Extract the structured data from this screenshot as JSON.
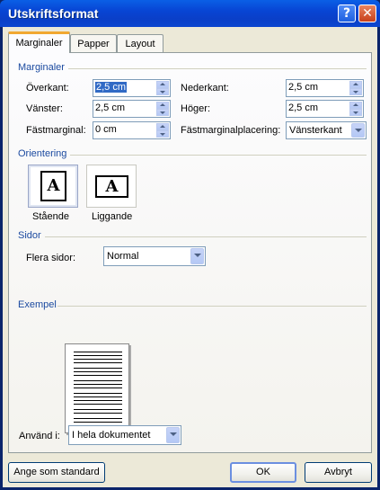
{
  "window": {
    "title": "Utskriftsformat",
    "help_glyph": "?",
    "close_glyph": "✕"
  },
  "tabs": [
    {
      "label": "Marginaler",
      "active": true
    },
    {
      "label": "Papper",
      "active": false
    },
    {
      "label": "Layout",
      "active": false
    }
  ],
  "margins": {
    "section_label": "Marginaler",
    "top": {
      "label": "Överkant:",
      "value": "2,5 cm"
    },
    "bottom": {
      "label": "Nederkant:",
      "value": "2,5 cm"
    },
    "left": {
      "label": "Vänster:",
      "value": "2,5 cm"
    },
    "right": {
      "label": "Höger:",
      "value": "2,5 cm"
    },
    "gutter": {
      "label": "Fästmarginal:",
      "value": "0 cm"
    },
    "gutter_position": {
      "label": "Fästmarginalplacering:",
      "value": "Vänsterkant"
    }
  },
  "orientation": {
    "section_label": "Orientering",
    "portrait": {
      "label": "Stående",
      "glyph": "A",
      "selected": true
    },
    "landscape": {
      "label": "Liggande",
      "glyph": "A",
      "selected": false
    }
  },
  "pages": {
    "section_label": "Sidor",
    "multiple_pages": {
      "label": "Flera sidor:",
      "value": "Normal"
    }
  },
  "preview": {
    "section_label": "Exempel"
  },
  "apply_to": {
    "label": "Använd i:",
    "value": "I hela dokumentet"
  },
  "buttons": {
    "default": "Ange som standard",
    "ok": "OK",
    "cancel": "Avbryt"
  },
  "colors": {
    "titlebar": "#0a4fd8",
    "section_label": "#1b4aa0",
    "selection": "#316ac5",
    "active_tab_accent": "#f1a831"
  },
  "icons": {
    "help": "help-icon",
    "close": "close-icon",
    "spin_up": "arrow-up-icon",
    "spin_down": "arrow-down-icon",
    "dropdown": "chevron-down-icon"
  }
}
